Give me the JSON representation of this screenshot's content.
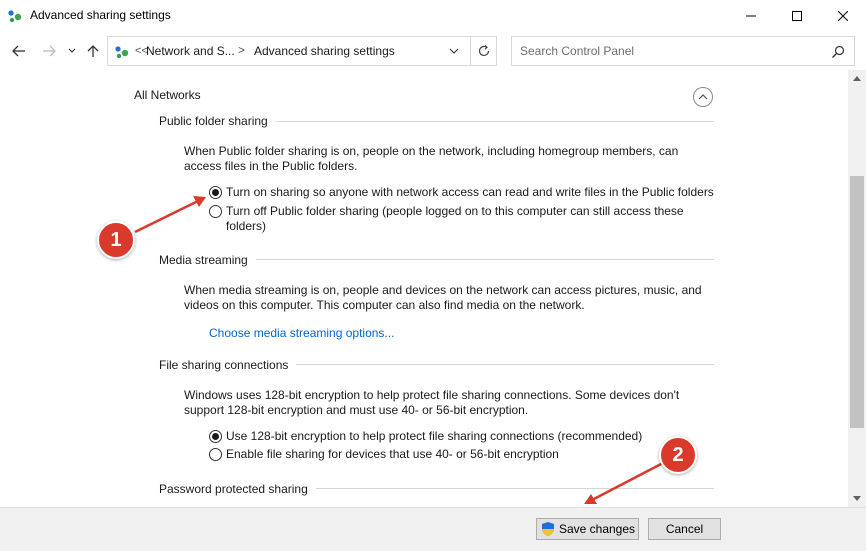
{
  "window": {
    "title": "Advanced sharing settings",
    "controls": {
      "minimize_icon": "minimize-icon",
      "maximize_icon": "maximize-icon",
      "close_icon": "close-icon"
    }
  },
  "navbar": {
    "breadcrumb_prefix": "<<",
    "crumb1": "Network and S...",
    "crumb_separator": ">",
    "crumb2": "Advanced sharing settings",
    "search_placeholder": "Search Control Panel"
  },
  "content": {
    "section_title": "All Networks",
    "public_folder": {
      "title": "Public folder sharing",
      "description": "When Public folder sharing is on, people on the network, including homegroup members, can access files in the Public folders.",
      "options": [
        {
          "label": "Turn on sharing so anyone with network access can read and write files in the Public folders",
          "checked": true
        },
        {
          "label": "Turn off Public folder sharing (people logged on to this computer can still access these folders)",
          "checked": false
        }
      ]
    },
    "media_streaming": {
      "title": "Media streaming",
      "description": "When media streaming is on, people and devices on the network can access pictures, music, and videos on this computer. This computer can also find media on the network.",
      "link": "Choose media streaming options..."
    },
    "file_sharing": {
      "title": "File sharing connections",
      "description": "Windows uses 128-bit encryption to help protect file sharing connections. Some devices don't support 128-bit encryption and must use 40- or 56-bit encryption.",
      "options": [
        {
          "label": "Use 128-bit encryption to help protect file sharing connections (recommended)",
          "checked": true
        },
        {
          "label": "Enable file sharing for devices that use 40- or 56-bit encryption",
          "checked": false
        }
      ]
    },
    "password_sharing": {
      "title": "Password protected sharing"
    }
  },
  "footer": {
    "save_label": "Save changes",
    "cancel_label": "Cancel"
  },
  "annotations": {
    "badge1": "1",
    "badge2": "2",
    "color": "#d93a2b"
  },
  "colors": {
    "link": "#0066cc",
    "accent_green": "#4caf50",
    "accent_blue": "#1e6fd9"
  }
}
